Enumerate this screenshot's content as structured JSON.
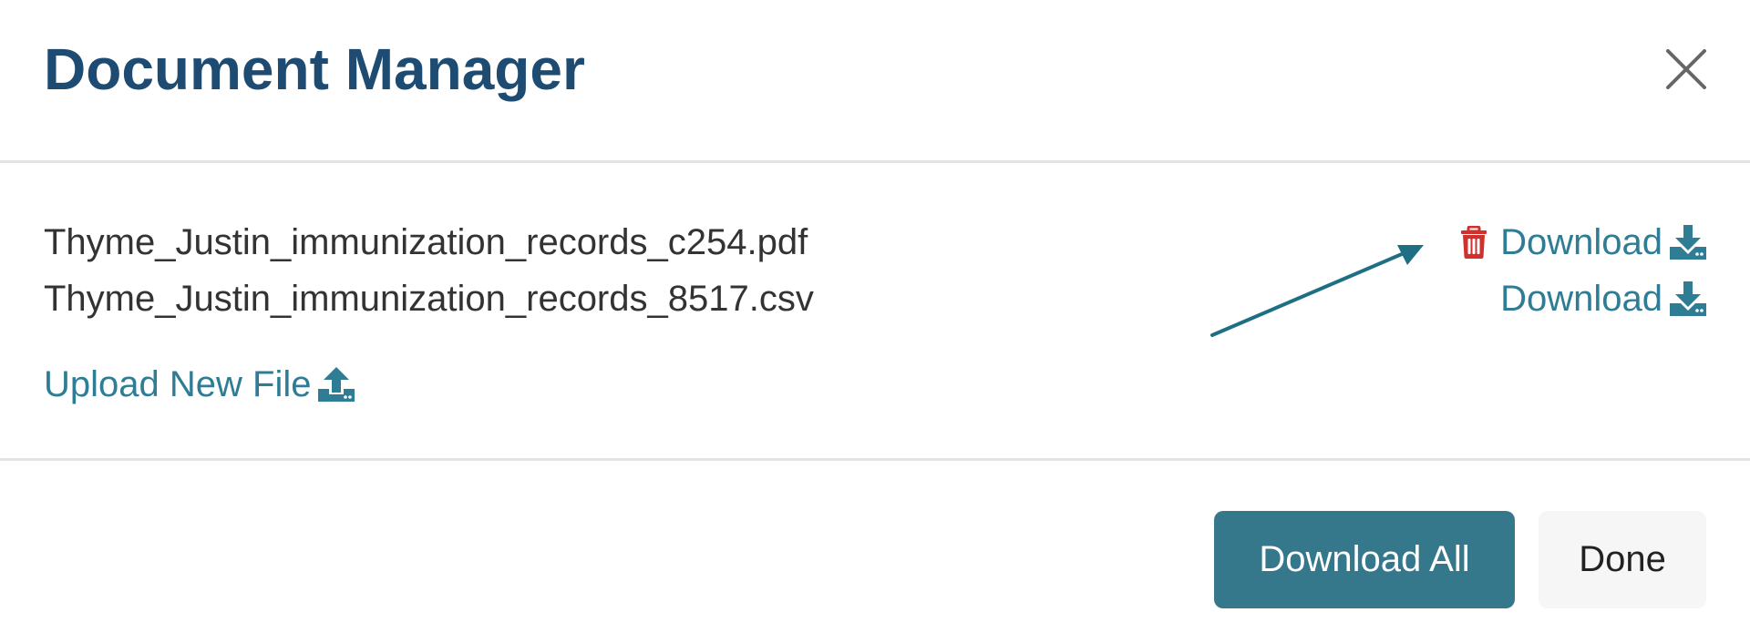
{
  "dialog": {
    "title": "Document Manager",
    "close_icon": "close-icon"
  },
  "files": [
    {
      "name": "Thyme_Justin_immunization_records_c254.pdf",
      "download_label": "Download",
      "has_delete": true
    },
    {
      "name": "Thyme_Justin_immunization_records_8517.csv",
      "download_label": "Download",
      "has_delete": false
    }
  ],
  "upload": {
    "label": "Upload New File",
    "icon": "upload-icon"
  },
  "footer": {
    "download_all_label": "Download All",
    "done_label": "Done"
  },
  "colors": {
    "title": "#1d4b72",
    "link": "#2f7d95",
    "delete": "#d0312d",
    "primary_button": "#35788c",
    "secondary_button": "#f6f6f6",
    "divider": "#e3e3e3"
  },
  "icons": {
    "delete": "trash-icon",
    "download": "download-icon",
    "upload": "upload-icon",
    "close": "close-icon"
  }
}
